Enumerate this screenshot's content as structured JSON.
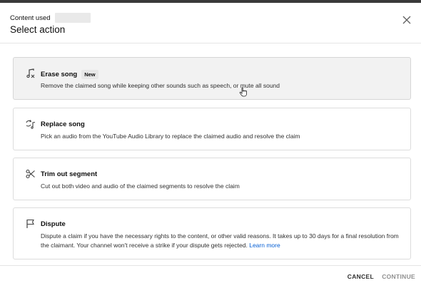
{
  "header": {
    "overline": "Content used",
    "title": "Select action"
  },
  "options": [
    {
      "title": "Erase song",
      "badge": "New",
      "description": "Remove the claimed song while keeping other sounds such as speech, or mute all sound",
      "icon": "music-note-erase-icon"
    },
    {
      "title": "Replace song",
      "description": "Pick an audio from the YouTube Audio Library to replace the claimed audio and resolve the claim",
      "icon": "replace-audio-icon"
    },
    {
      "title": "Trim out segment",
      "description": "Cut out both video and audio of the claimed segments to resolve the claim",
      "icon": "scissors-icon"
    },
    {
      "title": "Dispute",
      "description": "Dispute a claim if you have the necessary rights to the content, or other valid reasons. It takes up to 30 days for a final resolution from the claimant. Your channel won't receive a strike if your dispute gets rejected.",
      "link": "Learn more",
      "icon": "flag-icon"
    }
  ],
  "footer": {
    "cancel_label": "CANCEL",
    "continue_label": "CONTINUE"
  }
}
